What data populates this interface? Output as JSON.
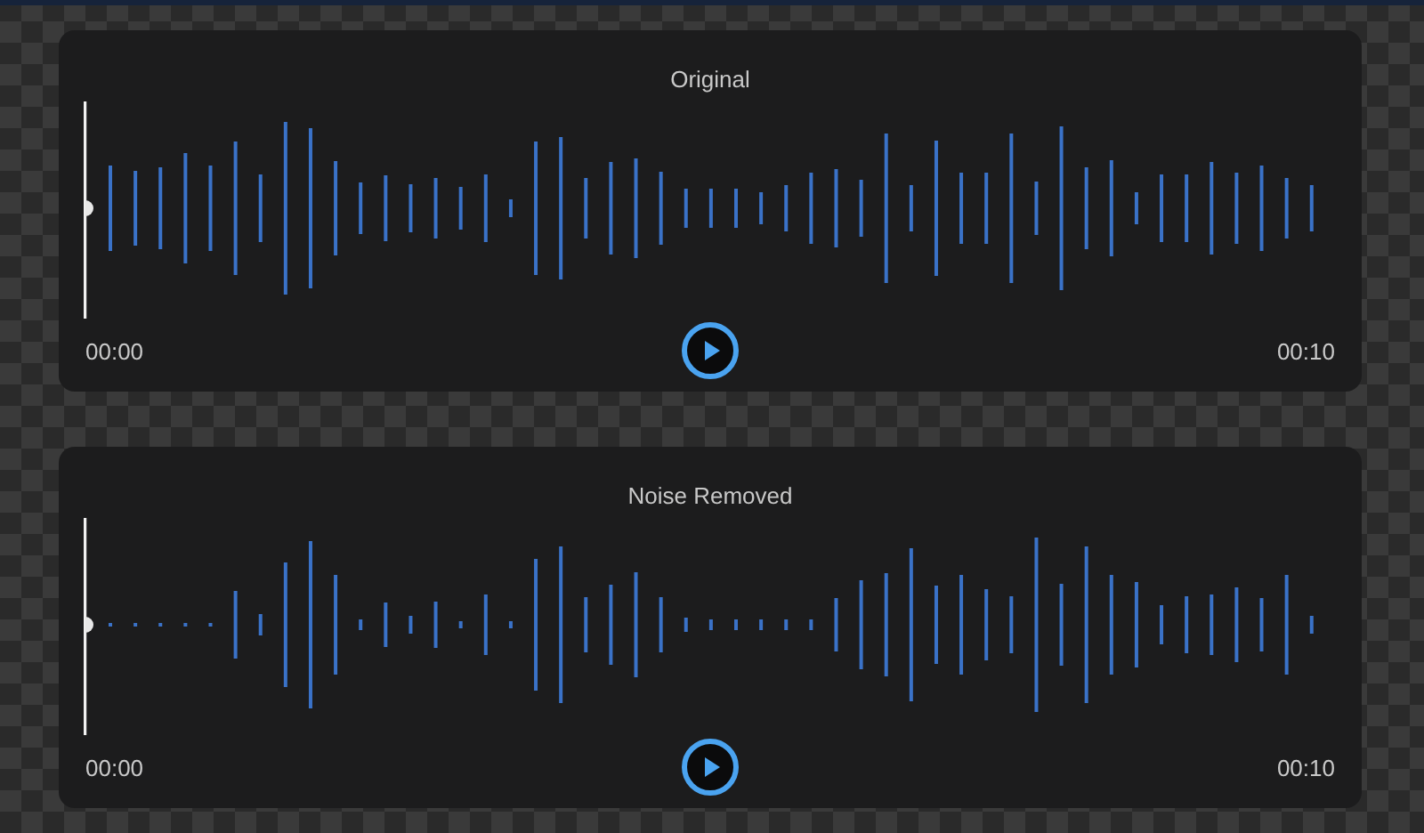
{
  "cards": [
    {
      "title": "Original",
      "playhead": {
        "level": 0
      },
      "start_time": "00:00",
      "end_time": "00:10"
    },
    {
      "title": "Noise Removed",
      "playhead": {
        "level": 0
      },
      "start_time": "00:00",
      "end_time": "00:10"
    }
  ]
}
